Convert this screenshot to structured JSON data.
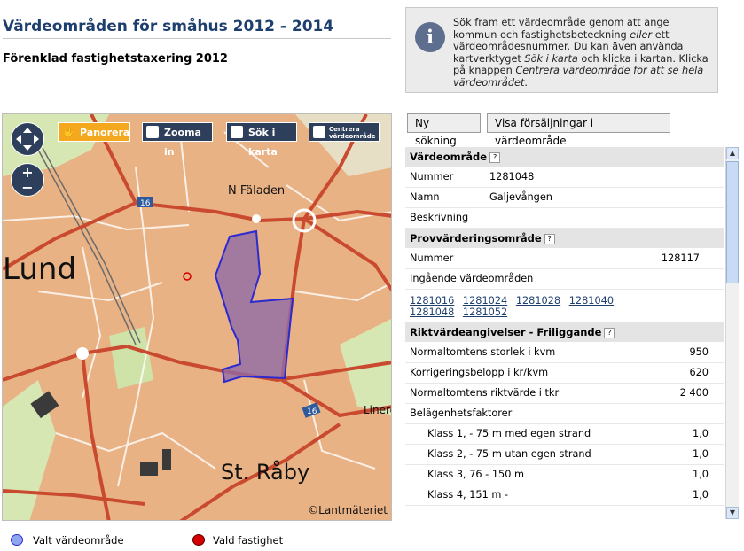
{
  "header": {
    "title": "Värdeområden för småhus 2012 - 2014",
    "subtitle": "Förenklad fastighetstaxering 2012"
  },
  "info": {
    "icon": "info-icon",
    "text_html": "Sök fram ett värdeområde genom att ange kommun och fastighetsbeteckning <i>eller</i> ett värdeområdesnummer. Du kan även använda kartverktyget <i>Sök i karta</i> och klicka i kartan. Klicka på knappen <i>Centrera värdeområde för att se hela värdeområdet</i>."
  },
  "map": {
    "tools": {
      "pan": "Panorera",
      "zoom_in": "Zooma in",
      "search_map": "Sök i karta",
      "center_line1": "Centrera",
      "center_line2": "värdeområde"
    },
    "zoom_plus": "+",
    "zoom_minus": "−",
    "labels": {
      "lund": "Lund",
      "n_faladen": "N Fäladen",
      "st_raby": "St. Råby",
      "linero": "Linero",
      "road16a": "16",
      "road16b": "16"
    },
    "copyright": "©Lantmäteriet",
    "colors": {
      "urban": "#e9b285",
      "green": "#cfe3a8",
      "road": "#c94a2f",
      "area_fill": "#8e6aa8",
      "area_stroke": "#2a2ad0"
    }
  },
  "buttons": {
    "new_search": "Ny sökning",
    "show_sales": "Visa försäljningar i värdeområde"
  },
  "panel": {
    "varde": {
      "heading": "Värdeområde",
      "help": "?",
      "rows": [
        {
          "label": "Nummer",
          "value": "1281048"
        },
        {
          "label": "Namn",
          "value": "Galjevången"
        },
        {
          "label": "Beskrivning",
          "value": ""
        }
      ]
    },
    "prov": {
      "heading": "Provvärderingsområde",
      "help": "?",
      "nummer_label": "Nummer",
      "nummer_value": "128117",
      "ingaende_label": "Ingående värdeområden",
      "links": [
        "1281016",
        "1281024",
        "1281028",
        "1281040",
        "1281048",
        "1281052"
      ]
    },
    "rikt": {
      "heading": "Riktvärdeangivelser - Friliggande",
      "help": "?",
      "rows": [
        {
          "label": "Normaltomtens storlek i kvm",
          "value": "950"
        },
        {
          "label": "Korrigeringsbelopp i kr/kvm",
          "value": "620"
        },
        {
          "label": "Normaltomtens riktvärde i tkr",
          "value": "2 400"
        }
      ],
      "belagenhet_label": "Belägenhetsfaktorer",
      "klasser": [
        {
          "label": "Klass 1, - 75 m med egen strand",
          "value": "1,0"
        },
        {
          "label": "Klass 2, - 75 m utan egen strand",
          "value": "1,0"
        },
        {
          "label": "Klass 3, 76 - 150 m",
          "value": "1,0"
        },
        {
          "label": "Klass 4, 151 m -",
          "value": "1,0"
        }
      ]
    }
  },
  "legend": {
    "area_label": "Valt värdeområde",
    "property_label": "Vald fastighet",
    "area_color": "#8fa6ef",
    "property_color": "#d40000"
  }
}
